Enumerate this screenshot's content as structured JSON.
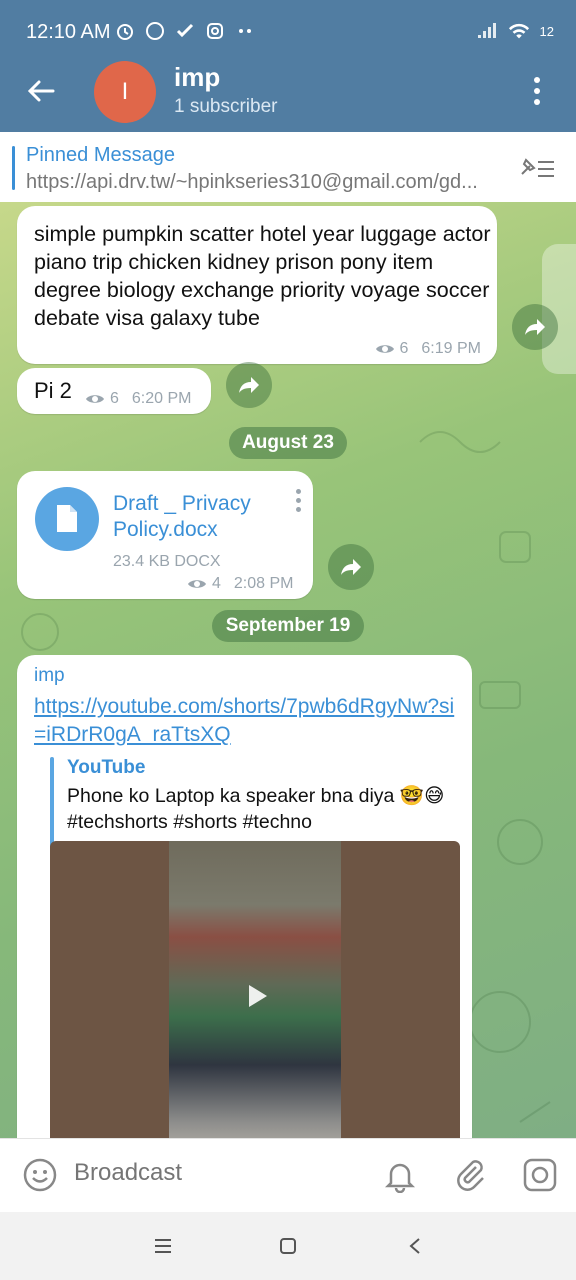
{
  "status_bar": {
    "time": "12:10 AM",
    "battery": "12"
  },
  "header": {
    "avatar_letter": "I",
    "title": "imp",
    "subtitle": "1 subscriber"
  },
  "pinned": {
    "title": "Pinned Message",
    "text": "https://api.drv.tw/~hpinkseries310@gmail.com/gd..."
  },
  "messages": [
    {
      "text": "simple pumpkin scatter hotel year luggage actor piano trip chicken kidney prison pony item degree biology exchange priority voyage soccer debate visa galaxy tube",
      "views": "6",
      "time": "6:19 PM"
    },
    {
      "text": "Pi 2",
      "views": "6",
      "time": "6:20 PM"
    },
    {
      "file_name": "Draft _ Privacy Policy.docx",
      "file_size": "23.4 KB DOCX",
      "views": "4",
      "time": "2:08 PM"
    },
    {
      "author": "imp",
      "link": "https://youtube.com/shorts/7pwb6dRgyNw?si=iRDrR0gA_raTtsXQ",
      "preview_site": "YouTube",
      "preview_title": "Phone ko Laptop ka speaker bna diya 🤓😅 #techshorts #shorts #techno"
    }
  ],
  "date_chips": {
    "first": "August 23",
    "second": "September 19"
  },
  "input": {
    "placeholder": "Broadcast"
  },
  "icons": [
    "back-arrow-icon",
    "more-vertical-icon",
    "pinned-list-icon",
    "eye-icon",
    "forward-icon",
    "document-icon",
    "play-icon",
    "emoji-icon",
    "bell-icon",
    "paperclip-icon",
    "camera-icon"
  ],
  "colors": {
    "header": "#517da2",
    "accent": "#3a8fd6",
    "avatar": "#e0674a"
  }
}
